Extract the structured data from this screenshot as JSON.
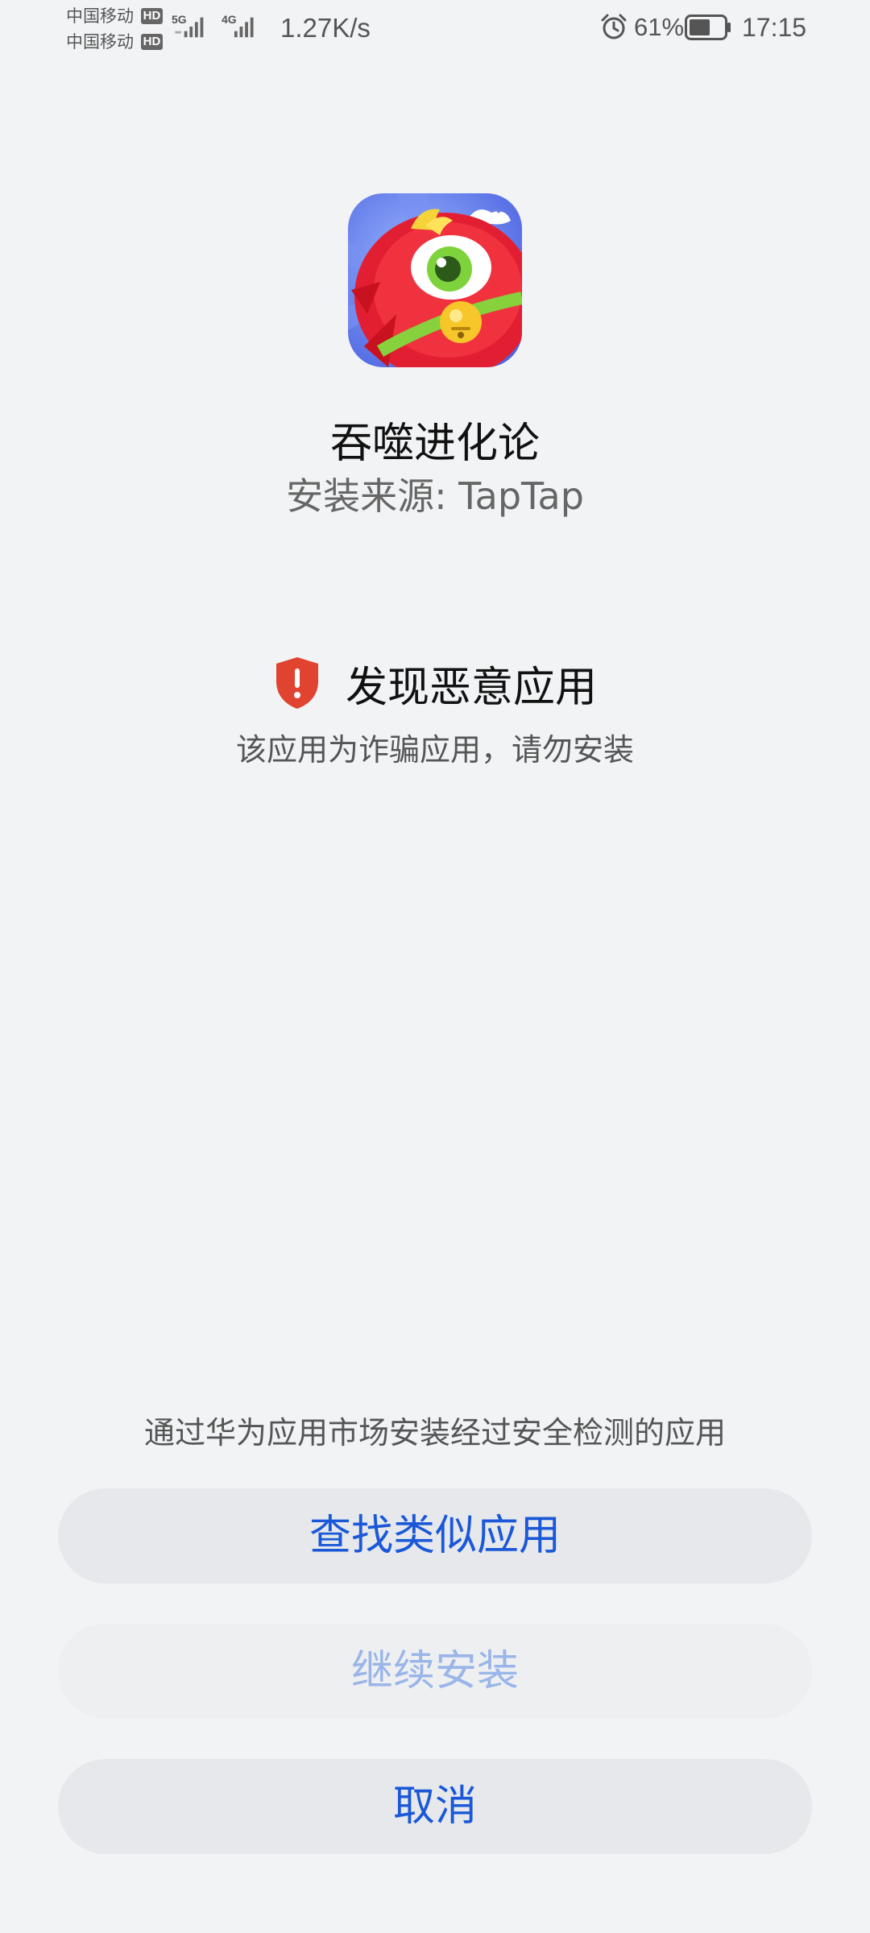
{
  "status_bar": {
    "carrier_1": "中国移动",
    "carrier_2": "中国移动",
    "hd_badge": "HD",
    "network_1": "5G",
    "network_2": "4G",
    "speed": "1.27K/s",
    "battery_percent": "61%",
    "battery_level": 0.61,
    "time": "17:15",
    "icons": [
      "alarm-icon",
      "battery-icon",
      "signal-icon"
    ]
  },
  "app": {
    "name": "吞噬进化论",
    "source": "安装来源: TapTap",
    "icon": "app-icon"
  },
  "warning": {
    "title": "发现恶意应用",
    "description": "该应用为诈骗应用，请勿安装",
    "icon": "shield-alert-icon",
    "color": "#e0432f"
  },
  "footer": {
    "tip": "通过华为应用市场安装经过安全检测的应用"
  },
  "buttons": {
    "find_similar": "查找类似应用",
    "continue_install": "继续安装",
    "cancel": "取消"
  },
  "colors": {
    "background": "#f1f3f5",
    "accent": "#1a58d8",
    "accent_disabled": "#9ab5e8",
    "button_bg": "#e6e8eb"
  }
}
